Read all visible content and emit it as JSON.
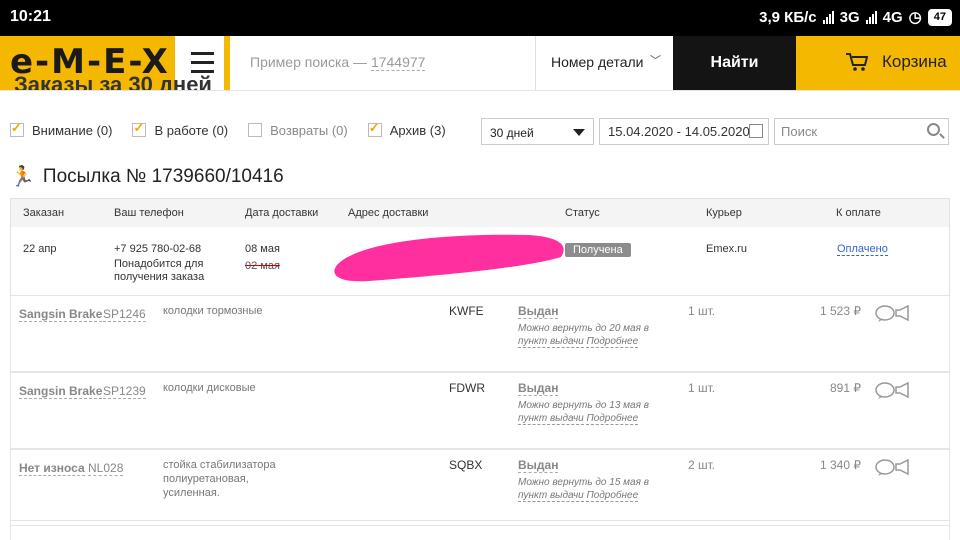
{
  "status_bar": {
    "time": "10:21",
    "speed": "3,9 КБ/с",
    "network1": "3G",
    "network2": "4G",
    "battery": "47"
  },
  "header": {
    "logo": "e-M-E-X",
    "search_placeholder_prefix": "Пример поиска — ",
    "search_placeholder_number": "1744977",
    "part_select_label": "Номер детали",
    "find_button": "Найти",
    "cart_label": "Корзина"
  },
  "page_title_partial": "Заказы за 30 дней",
  "filters": [
    {
      "label": "Внимание (0)",
      "checked": true
    },
    {
      "label": "В работе (0)",
      "checked": true
    },
    {
      "label": "Возвраты (0)",
      "checked": false
    },
    {
      "label": "Архив (3)",
      "checked": true
    }
  ],
  "period_select": "30 дней",
  "date_range": "15.04.2020 - 14.05.2020",
  "search_placeholder": "Поиск",
  "parcel": {
    "title": "Посылка № 1739660/10416",
    "headers": [
      "Заказан",
      "Ваш телефон",
      "Дата доставки",
      "Адрес доставки",
      "Статус",
      "Курьер",
      "К оплате"
    ],
    "ordered": "22 апр",
    "phone": "+7 925 780-02-68",
    "phone_note": "Понадобится для получения заказа",
    "delivery_date": "08 мая",
    "delivery_date_old": "02 мая",
    "status": "Получена",
    "courier": "Emex.ru",
    "payment": "Оплачено"
  },
  "items": [
    {
      "brand": "Sangsin Brake",
      "code": "SP1246",
      "desc": "колодки тормозные",
      "supplier": "KWFE",
      "status": "Выдан",
      "note_prefix": "Можно вернуть до 20 мая в ",
      "note_link1": "пункт выдачи",
      "note_link2": "Подробнее",
      "qty": "1 шт.",
      "price": "1 523 ₽"
    },
    {
      "brand": "Sangsin Brake",
      "code": "SP1239",
      "desc": "колодки дисковые",
      "supplier": "FDWR",
      "status": "Выдан",
      "note_prefix": "Можно вернуть до 13 мая в ",
      "note_link1": "пункт выдачи",
      "note_link2": "Подробнее",
      "qty": "1 шт.",
      "price": "891 ₽"
    },
    {
      "brand": "Нет износа",
      "code": "NL028",
      "desc": "стойка стабилизатора полиуретановая, усиленная.",
      "supplier": "SQBX",
      "status": "Выдан",
      "note_prefix": "Можно вернуть до 15 мая в ",
      "note_link1": "пункт выдачи",
      "note_link2": "Подробнее",
      "qty": "2 шт.",
      "price": "1 340 ₽"
    }
  ],
  "colors": {
    "brand_yellow": "#f5b800",
    "redaction_pink": "#ff2fa0",
    "link_blue": "#3366cc"
  }
}
